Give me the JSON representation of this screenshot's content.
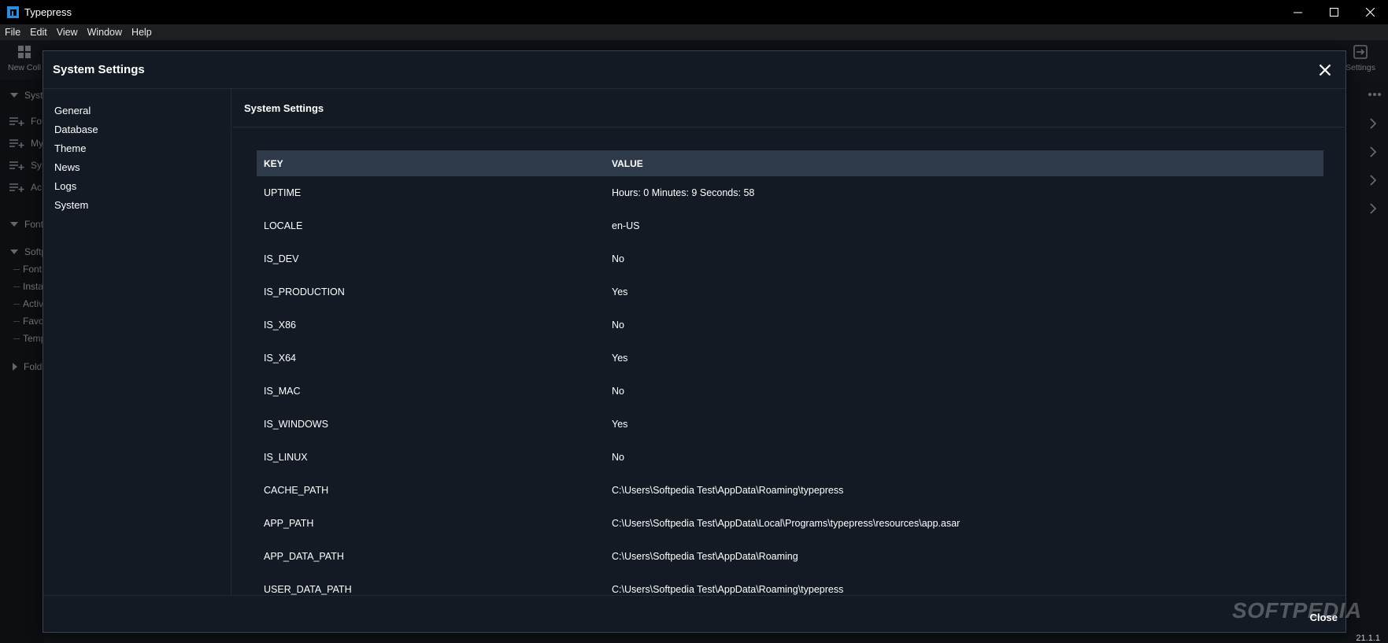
{
  "window": {
    "title": "Typepress",
    "minimize_icon": "minimize-icon",
    "maximize_icon": "maximize-icon",
    "close_icon": "close-icon"
  },
  "menu": [
    "File",
    "Edit",
    "View",
    "Window",
    "Help"
  ],
  "background": {
    "toolbar": {
      "new_collection_label": "New Coll",
      "settings_label": "Settings"
    },
    "sidebar": {
      "items": [
        {
          "label": "Syst",
          "kind": "section-open"
        },
        {
          "label": "Fo",
          "kind": "add-item"
        },
        {
          "label": "My",
          "kind": "add-item"
        },
        {
          "label": "Sy",
          "kind": "add-item"
        },
        {
          "label": "Ac",
          "kind": "add-item"
        },
        {
          "label": "Font",
          "kind": "section-open"
        },
        {
          "label": "Softp",
          "kind": "section-open"
        },
        {
          "label": "Font",
          "kind": "tree-child"
        },
        {
          "label": "Insta",
          "kind": "tree-child"
        },
        {
          "label": "Activ",
          "kind": "tree-child"
        },
        {
          "label": "Favo",
          "kind": "tree-child"
        },
        {
          "label": "Temp",
          "kind": "tree-child"
        },
        {
          "label": "Fold",
          "kind": "section-closed"
        }
      ]
    },
    "version": "21.1.1",
    "watermark": "SOFTPEDIA"
  },
  "modal": {
    "title": "System Settings",
    "nav": [
      "General",
      "Database",
      "Theme",
      "News",
      "Logs",
      "System"
    ],
    "content_title": "System Settings",
    "table": {
      "headers": [
        "KEY",
        "VALUE"
      ],
      "rows": [
        [
          "UPTIME",
          "Hours: 0 Minutes: 9 Seconds: 58"
        ],
        [
          "LOCALE",
          "en-US"
        ],
        [
          "IS_DEV",
          "No"
        ],
        [
          "IS_PRODUCTION",
          "Yes"
        ],
        [
          "IS_X86",
          "No"
        ],
        [
          "IS_X64",
          "Yes"
        ],
        [
          "IS_MAC",
          "No"
        ],
        [
          "IS_WINDOWS",
          "Yes"
        ],
        [
          "IS_LINUX",
          "No"
        ],
        [
          "CACHE_PATH",
          "C:\\Users\\Softpedia Test\\AppData\\Roaming\\typepress"
        ],
        [
          "APP_PATH",
          "C:\\Users\\Softpedia Test\\AppData\\Local\\Programs\\typepress\\resources\\app.asar"
        ],
        [
          "APP_DATA_PATH",
          "C:\\Users\\Softpedia Test\\AppData\\Roaming"
        ],
        [
          "USER_DATA_PATH",
          "C:\\Users\\Softpedia Test\\AppData\\Roaming\\typepress"
        ]
      ]
    },
    "footer_close_label": "Close"
  }
}
